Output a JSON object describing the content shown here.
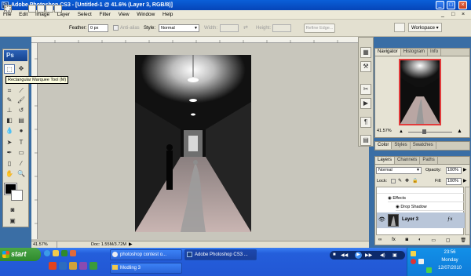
{
  "window": {
    "title": "Adobe Photoshop CS3 - [Untitled-1 @ 41.6% (Layer 3, RGB/8)]",
    "app_icon": "Ps",
    "controls": [
      "_",
      "□",
      "×"
    ],
    "doc_controls": [
      "_",
      "□",
      "×"
    ]
  },
  "menu": [
    "File",
    "Edit",
    "Image",
    "Layer",
    "Select",
    "Filter",
    "View",
    "Window",
    "Help"
  ],
  "options": {
    "feather_label": "Feather:",
    "feather_value": "0 px",
    "antialias_label": "Anti-alias",
    "style_label": "Style:",
    "style_value": "Normal",
    "width_label": "Width:",
    "height_label": "Height:",
    "refine_edge": "Refine Edge...",
    "workspace": "Workspace"
  },
  "toolbox": {
    "logo": "Ps",
    "tooltip": "Rectangular Marquee Tool (M)"
  },
  "status": {
    "zoom": "41.57%",
    "doc": "Doc: 1.55M/3.72M"
  },
  "navigator": {
    "tabs": [
      "Navigator",
      "Histogram",
      "Info"
    ],
    "zoom": "41.57%"
  },
  "color_panel": {
    "tabs": [
      "Color",
      "Styles",
      "Swatches"
    ]
  },
  "layers": {
    "tabs": [
      "Layers",
      "Channels",
      "Paths"
    ],
    "blend_mode": "Normal",
    "opacity_label": "Opacity:",
    "opacity_value": "100%",
    "lock_label": "Lock:",
    "fill_label": "Fill:",
    "fill_value": "100%",
    "effects_label": "Effects",
    "drop_shadow_label": "Drop Shadow",
    "layer_name": "Layer 3",
    "footer_icons": [
      "link-icon",
      "fx-icon",
      "mask-icon",
      "adjustment-icon",
      "folder-icon",
      "new-layer-icon",
      "trash-icon"
    ]
  },
  "taskbar": {
    "start": "start",
    "tasks": [
      {
        "label": "photoshop contest o...",
        "active": false
      },
      {
        "label": "Adobe Photoshop CS3 ...",
        "active": true
      },
      {
        "label": "Modling 3",
        "active": false
      }
    ],
    "time": "23:56",
    "day": "Monday",
    "date": "12/07/2010"
  }
}
